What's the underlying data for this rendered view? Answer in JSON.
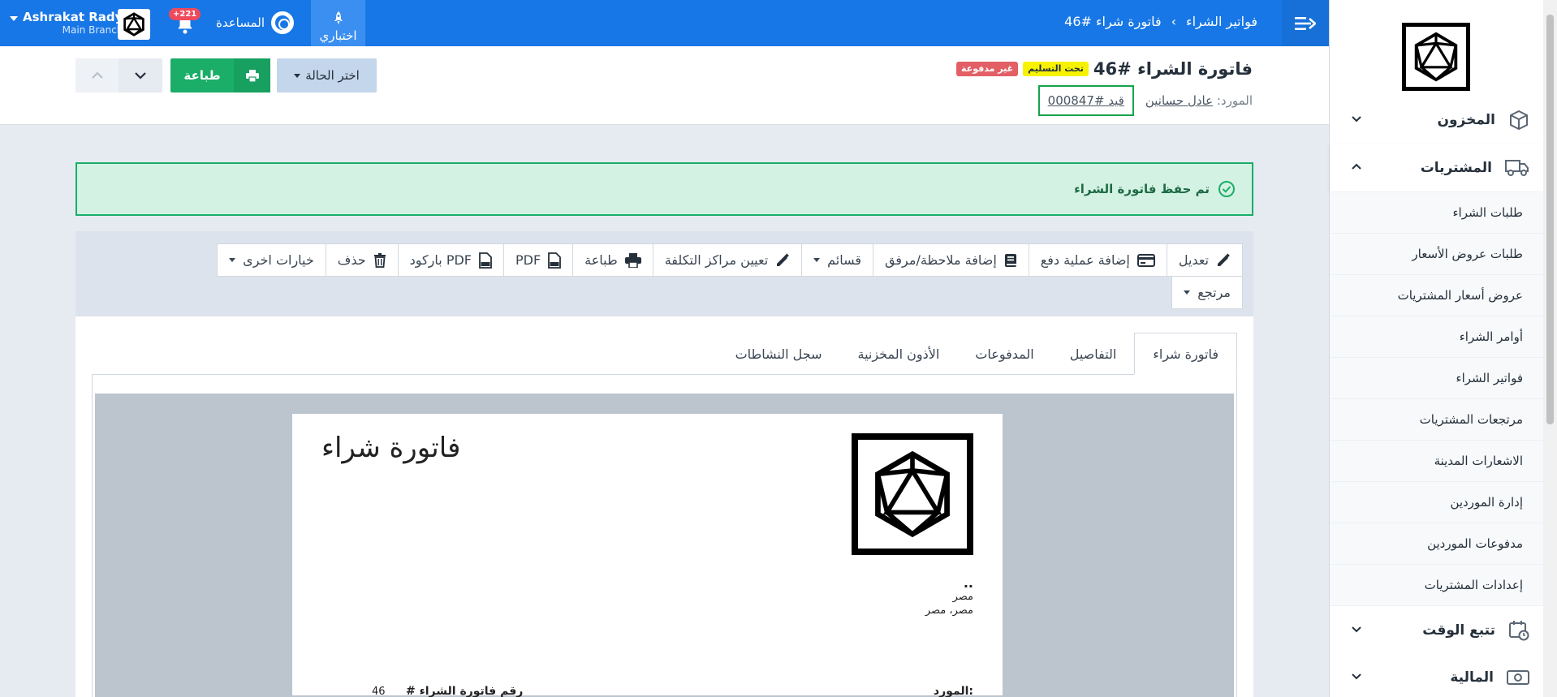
{
  "topbar": {
    "user_name": "Ashrakat Rady",
    "branch": "Main Branch",
    "notifications_count": "+221",
    "help_label": "المساعدة",
    "trial_label": "اختباري",
    "breadcrumb": [
      "فواتير الشراء",
      "فاتورة شراء #46"
    ],
    "breadcrumb_sep": "›"
  },
  "header": {
    "title": "فاتورة الشراء",
    "title_number": "#46",
    "tag_delivery": "تحت التسليم",
    "tag_payment": "غير مدفوعة",
    "supplier_label": "المورد:",
    "supplier_name": "عادل حسانين",
    "entry_link": "قيد #000847",
    "status_button": "اختر الحالة",
    "print_button": "طباعة"
  },
  "alert": {
    "message": "تم حفظ فاتورة الشراء"
  },
  "toolbar": {
    "edit": "تعديل",
    "add_payment": "إضافة عملية دفع",
    "add_note": "إضافة ملاحظة/مرفق",
    "lists": "قسائم",
    "assign_cost_centers": "تعيين مراكز التكلفة",
    "print": "طباعة",
    "pdf": "PDF",
    "pdf_barcode": "PDF باركود",
    "delete": "حذف",
    "more_options": "خيارات اخرى",
    "returned": "مرتجع"
  },
  "tabs": [
    "فاتورة شراء",
    "التفاصيل",
    "المدفوعات",
    "الأذون المخزنية",
    "سجل النشاطات"
  ],
  "preview": {
    "doc_title": "فاتورة شراء",
    "company_dots": "..",
    "address_line1": "مصر",
    "address_line2": "مصر، مصر",
    "supplier_label": "المورد:",
    "invoice_no_label": "رقم فاتورة الشراء #",
    "invoice_no_value": "46"
  },
  "sidebar": {
    "inventory": "المخزون",
    "purchases": "المشتريات",
    "sub_items": [
      "طلبات الشراء",
      "طلبات عروض الأسعار",
      "عروض أسعار المشتريات",
      "أوامر الشراء",
      "فواتير الشراء",
      "مرتجعات المشتريات",
      "الاشعارات المدينة",
      "إدارة الموردين",
      "مدفوعات الموردين",
      "إعدادات المشتريات"
    ],
    "time_tracking": "تتبع الوقت",
    "finance": "المالية"
  },
  "colors": {
    "primary": "#1877e6",
    "success": "#1aae68",
    "tag_yellow": "#f7f300",
    "tag_red": "#e35f66",
    "entry_highlight": "#16a34a"
  }
}
